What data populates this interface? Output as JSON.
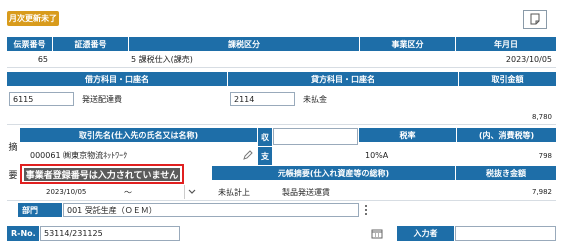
{
  "status_badge": "月次更新未了",
  "row1": {
    "headers": [
      "伝票番号",
      "証憑番号",
      "課税区分",
      "事業区分",
      "年月日"
    ],
    "values": {
      "slip_no": "65",
      "voucher_no": "",
      "tax_class": "5 課税仕入(課売)",
      "business_class": "",
      "date": "2023/10/05"
    }
  },
  "row2": {
    "headers": [
      "借方科目・口座名",
      "貸方科目・口座名",
      "取引金額"
    ],
    "debit_code": "6115",
    "debit_name": "発送配達費",
    "credit_code": "2114",
    "credit_name": "未払金",
    "amount": "8,780"
  },
  "row3": {
    "side_labels": [
      "摘",
      "要"
    ],
    "headers": {
      "partner": "取引先名(仕入先の氏名又は名称)",
      "shu": "収",
      "shi": "支",
      "tax_rate": "税率",
      "tax_amount": "(内、消費税等)"
    },
    "partner_value": "000061 ㈱東京物流ﾈｯﾄﾜｰｸ",
    "tax_rate_value": "10%A",
    "tax_amount_value": "798",
    "tooltip": "事業者登録番号は入力されていません"
  },
  "row4": {
    "headers": {
      "desc": "元帳摘要(仕入れ資産等の総称)",
      "net": "税抜き金額"
    },
    "date_from": "2023/10/05",
    "tilde": "～",
    "desc_code": "未払計上",
    "desc_text": "製品発送運賃",
    "net_value": "7,982"
  },
  "row5": {
    "label": "部門",
    "value": "001 受託生産（ＯＥＭ）"
  },
  "row6": {
    "label": "R-No.",
    "value": "53114/231125",
    "entrant_label": "入力者",
    "entrant_value": ""
  },
  "icons": [
    "note-icon",
    "pencil-icon",
    "chevron-down-icon",
    "more-icon",
    "calendar-icon"
  ]
}
